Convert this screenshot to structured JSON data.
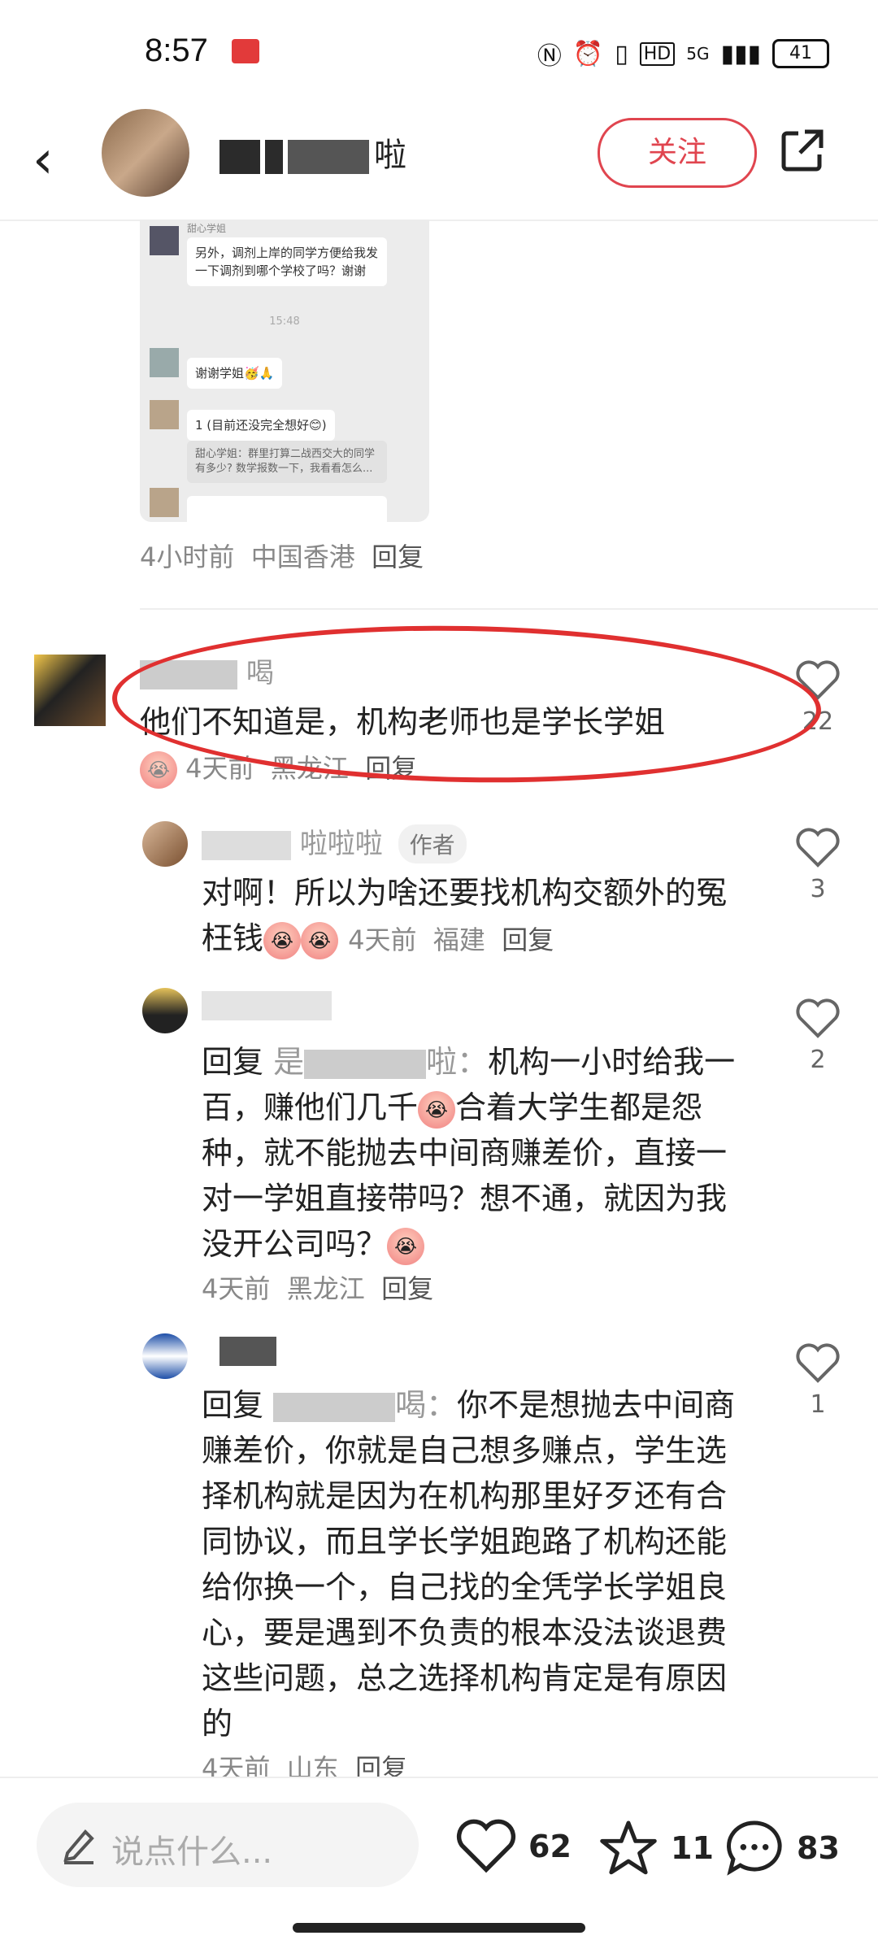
{
  "status_bar": {
    "time": "8:57",
    "network": "5G",
    "battery": "41"
  },
  "header": {
    "author_suffix": "啦",
    "follow_label": "关注"
  },
  "chat_image": {
    "sender_name": "甜心学姐",
    "msg1": "另外，调剂上岸的同学方便给我发一下调剂到哪个学校了吗？谢谢",
    "time_label": "15:48",
    "msg2": "谢谢学姐🥳🙏",
    "msg3": "1 (目前还没完全想好😊)",
    "msg4": "甜心学姐：群里打算二战西交大的同学有多少? 数学报数一下，我看看怎么..."
  },
  "prev_comment_meta": {
    "time": "4小时前",
    "location": "中国香港",
    "reply": "回复"
  },
  "comments": [
    {
      "name_visible": "喝",
      "text": "他们不知道是，机构老师也是学长学姐",
      "time": "4天前",
      "location": "黑龙江",
      "reply": "回复",
      "likes": "22"
    },
    {
      "name_visible": "啦啦啦",
      "tag": "作者",
      "text": "对啊！所以为啥还要找机构交额外的冤枉钱",
      "time": "4天前",
      "location": "福建",
      "reply": "回复",
      "likes": "3"
    },
    {
      "reply_prefix": "回复",
      "reply_target_visible": "是",
      "reply_target_suffix": "啦：",
      "text": "机构一小时给我一百，赚他们几千",
      "text_2": "合着大学生都是怨种，就不能抛去中间商赚差价，直接一对一学姐直接带吗？想不通，就因为我没开公司吗？",
      "time": "4天前",
      "location": "黑龙江",
      "reply": "回复",
      "likes": "2"
    },
    {
      "reply_prefix": "回复",
      "reply_target_suffix": "喝：",
      "text": "你不是想抛去中间商赚差价，你就是自己想多赚点，学生选择机构就是因为在机构那里好歹还有合同协议，而且学长学姐跑路了机构还能给你换一个，自己找的全凭学长学姐良心，要是遇到不负责的根本没法谈退费这些问题，总之选择机构肯定是有原因的",
      "time": "4天前",
      "location": "山东",
      "reply": "回复",
      "likes": "1"
    }
  ],
  "bottom_bar": {
    "input_placeholder": "说点什么...",
    "likes": "62",
    "stars": "11",
    "comments": "83"
  }
}
